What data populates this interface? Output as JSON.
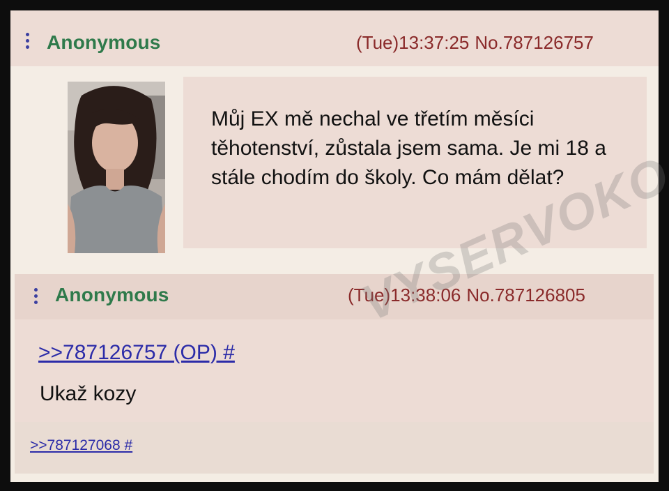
{
  "op": {
    "name": "Anonymous",
    "datetime": "(Tue)13:37:25",
    "post_number": "No.787126757",
    "body": "Můj EX mě nechal ve třetím měsíci těhotenství, zůstala jsem sama. Je mi 18 a stále chodím do školy. Co mám dělat?"
  },
  "reply": {
    "name": "Anonymous",
    "datetime": "(Tue)13:38:06",
    "post_number": "No.787126805",
    "quote_link": ">>787126757 (OP) #",
    "body": "Ukaž kozy",
    "backlink": ">>787127068 #"
  },
  "watermark": "VYSERVOKO",
  "colors": {
    "name": "#2f7a4b",
    "link": "#2b2ba8",
    "meta": "#8a2a2a",
    "post_bg": "#eddcd5",
    "page_bg": "#f4ede4"
  }
}
